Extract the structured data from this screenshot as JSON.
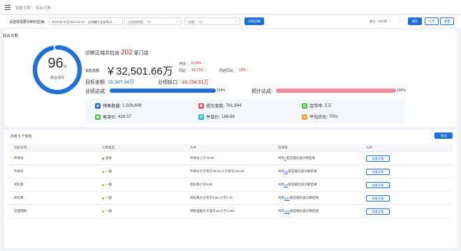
{
  "topbar": {
    "breadcrumb": [
      "智能诊断",
      "综合诊断"
    ]
  },
  "filters": {
    "label": "请选择需要诊断的店铺:",
    "date_range": "2024-01-01至2024-12-24",
    "shop_select": "店铺编号全部等13...",
    "category_select": "自动选择类",
    "brand_select": "按客",
    "diagnose_button": "开始诊断",
    "recent_select": "最后一次诊断",
    "save_button": "保存",
    "share_button": "分享",
    "reset_button": "重置"
  },
  "summary": {
    "title": "综合诊断",
    "score": "96",
    "score_unit": "分",
    "score_label": "综合评分",
    "stores_prefix": "诊断区域共包含",
    "stores_count": "202",
    "stores_suffix": "家门店",
    "sales_label": "销售金额:",
    "sales_value": "￥32,501.66万",
    "mom_label": "环比:",
    "mom_value": "0.24% ↑",
    "yoy_label": "同比:",
    "yoy_value": "14.72% ↑",
    "store_yoy_label": "同店同比:",
    "store_yoy_value": "13% ↑",
    "target_label": "目标金额:",
    "target_value": "16,347.34万",
    "gap_label": "业绩缺口:",
    "gap_value": "-16,154.31万",
    "achieve_label": "业绩达成:",
    "achieve_pct": "199%",
    "achieve_fill": 1.0,
    "forecast_label": "预计达成:",
    "forecast_pct": "199%",
    "forecast_fill": 1.0
  },
  "stats": [
    {
      "label": "销售数量:",
      "value": "1,926,606",
      "color": "#1f6fd6",
      "icon": "cart-icon"
    },
    {
      "label": "成交单数:",
      "value": "761,904",
      "color": "#e8505b",
      "icon": "order-icon"
    },
    {
      "label": "连带率:",
      "value": "2.5",
      "color": "#52b94a",
      "icon": "link-icon"
    },
    {
      "label": "客单价:",
      "value": "426.57",
      "color": "#52b94a",
      "icon": "customer-icon"
    },
    {
      "label": "件单价:",
      "value": "168.69",
      "color": "#2bb5c7",
      "icon": "item-price-icon"
    },
    {
      "label": "平均折扣:",
      "value": "70%",
      "color": "#f29d38",
      "icon": "discount-icon"
    }
  ],
  "table": {
    "title": "共有 5 个状态",
    "export": "导出",
    "headers": [
      "指标名称",
      "诊断类型",
      "条件",
      "店铺数",
      "分析"
    ],
    "rows": [
      {
        "name": "件单价",
        "type": "良好",
        "type_color": "#52b94a",
        "cond": "件单价小于70.00",
        "pre": "共有 ",
        "num": "1",
        "post": " 家店铺为该诊断结果",
        "btn": "查看详情"
      },
      {
        "name": "件单价",
        "type": "一般",
        "type_color": "#f29d38",
        "cond": "件单价大于等于70.00,小于等于100.00",
        "pre": "共有 ",
        "num": "33",
        "post": " 家店铺为该诊断结果",
        "btn": "查看详情"
      },
      {
        "name": "折扣率",
        "type": "一般",
        "type_color": "#f29d38",
        "cond": "折扣率小于0.50",
        "pre": "共有 ",
        "num": "33",
        "post": " 家店铺为该诊断结果",
        "btn": "查看详情"
      },
      {
        "name": "折扣率",
        "type": "一般",
        "type_color": "#f29d38",
        "cond": "折扣率大于等于0.50,小于0.70",
        "pre": "共有 ",
        "num": "107",
        "post": " 家店铺为该诊断结果",
        "btn": "查看详情"
      },
      {
        "name": "店铺销售",
        "type": "一般",
        "type_color": "#f29d38",
        "cond": "销售金额大于等于10,小于1,200",
        "pre": "共有 ",
        "num": "201",
        "post": " 家店铺为该诊断结果",
        "btn": "查看详情"
      }
    ]
  }
}
